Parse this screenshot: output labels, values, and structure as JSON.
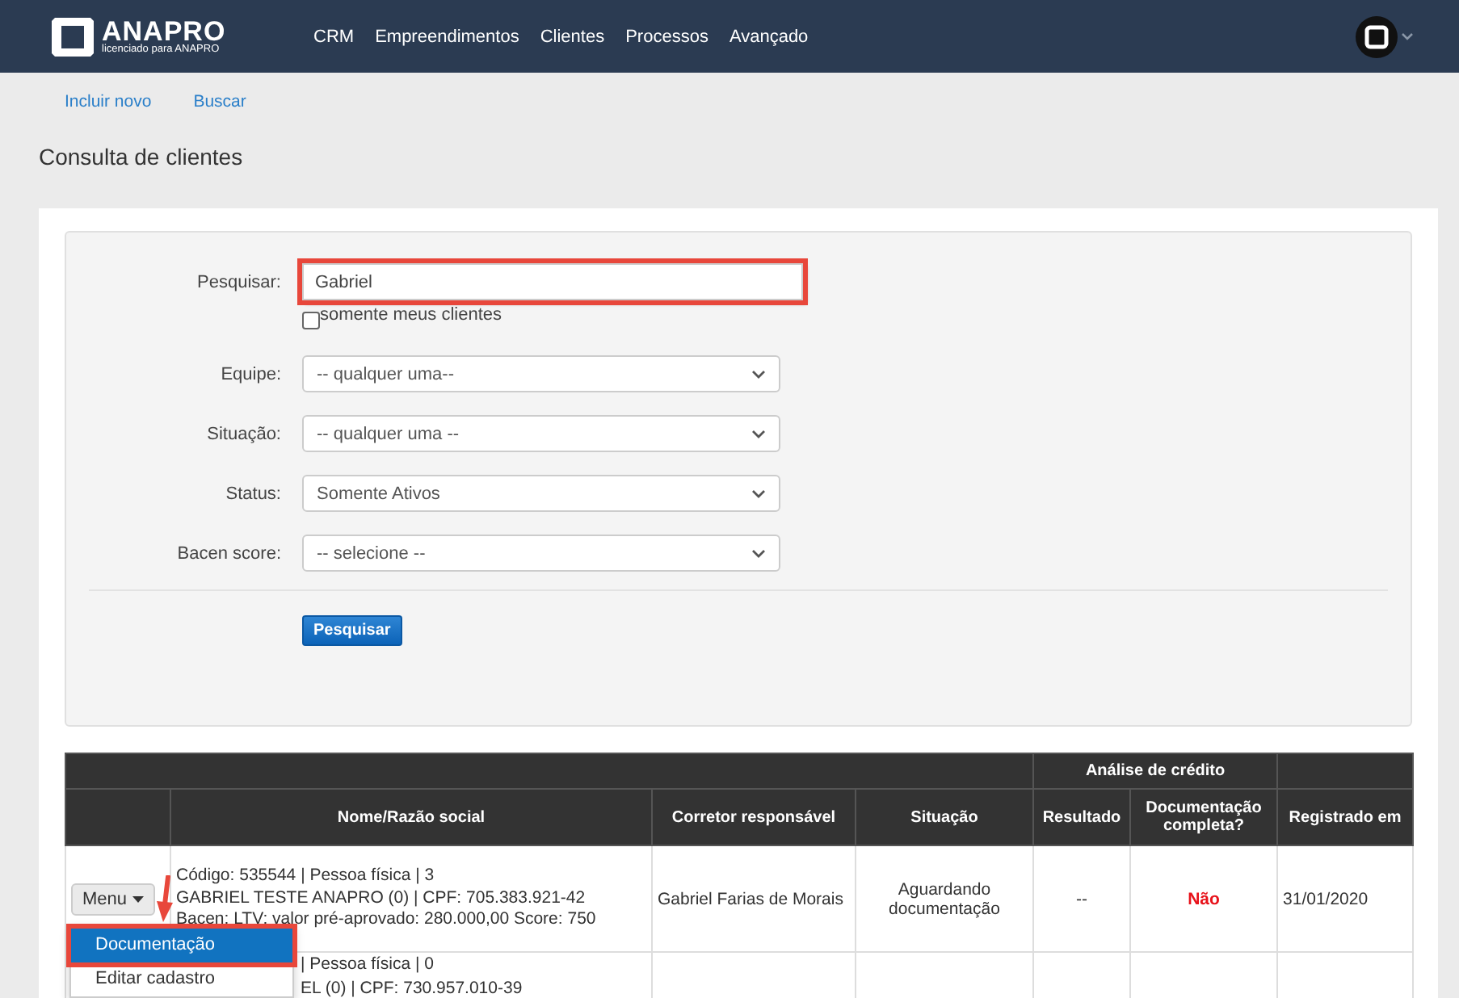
{
  "brand": {
    "name": "ANAPRO",
    "tagline": "licenciado para ANAPRO"
  },
  "nav": [
    "CRM",
    "Empreendimentos",
    "Clientes",
    "Processos",
    "Avançado"
  ],
  "subnav": [
    "Incluir novo",
    "Buscar"
  ],
  "page_title": "Consulta de clientes",
  "search_form": {
    "search": {
      "label": "Pesquisar:",
      "value": "Gabriel",
      "highlighted": true
    },
    "only_mine": {
      "label": "somente meus clientes",
      "checked": false
    },
    "selects": [
      {
        "label": "Equipe:",
        "value": "-- qualquer uma--"
      },
      {
        "label": "Situação:",
        "value": "-- qualquer uma --"
      },
      {
        "label": "Status:",
        "value": "Somente Ativos"
      },
      {
        "label": "Bacen score:",
        "value": "-- selecione --"
      }
    ],
    "submit": "Pesquisar"
  },
  "table": {
    "group_header": "Análise de crédito",
    "columns": [
      "Nome/Razão social",
      "Corretor responsável",
      "Situação",
      "Resultado",
      "Documentação completa?",
      "Registrado em"
    ],
    "rows": [
      {
        "name_lines": [
          "Código: 535544 | Pessoa física | 3",
          "GABRIEL TESTE ANAPRO (0) | CPF: 705.383.921-42",
          "Bacen: LTV: valor pré-aprovado: 280.000,00 Score: 750"
        ],
        "broker": "Gabriel Farias de Morais",
        "situation": "Aguardando documentação",
        "result": "--",
        "doc_complete": "Não",
        "registered": "31/01/2020"
      },
      {
        "name_lines": [
          "| Pessoa física | 0",
          "EL (0) | CPF: 730.957.010-39"
        ]
      }
    ]
  },
  "row_menu": {
    "button": "Menu",
    "items": [
      {
        "label": "Documentação",
        "selected": true
      },
      {
        "label": "Editar cadastro",
        "selected": false
      }
    ]
  }
}
